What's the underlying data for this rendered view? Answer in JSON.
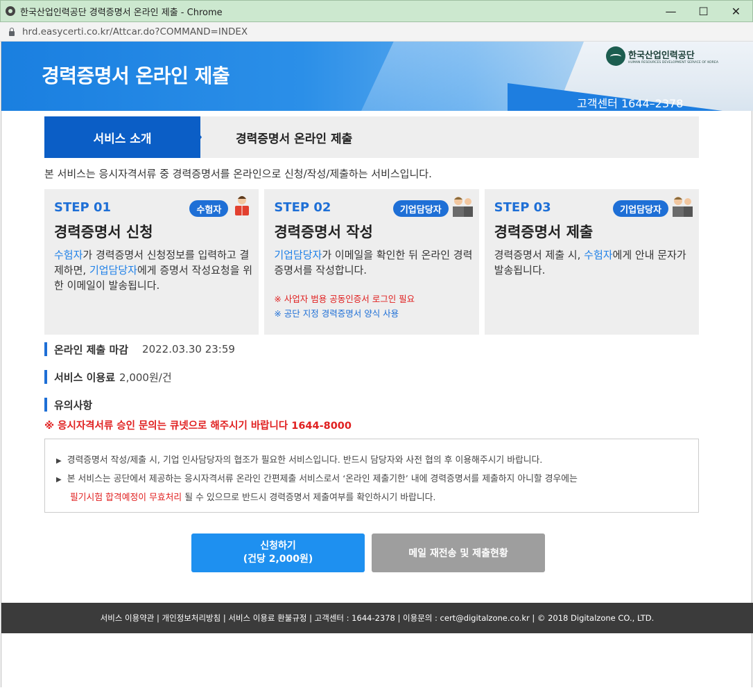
{
  "window": {
    "title": "한국산업인력공단 경력증명서 온라인 제출 - Chrome",
    "url": "hrd.easycerti.co.kr/Attcar.do?COMMAND=INDEX",
    "minimize": "—",
    "maximize": "☐",
    "close": "✕"
  },
  "banner": {
    "title": "경력증명서 온라인 제출",
    "hotline": "고객센터 1644–2378",
    "logo_name": "한국산업인력공단",
    "logo_sub": "HUMAN RESOURCES DEVELOPMENT SERVICE OF KOREA"
  },
  "tabs": {
    "active": "서비스 소개",
    "current": "경력증명서 온라인 제출"
  },
  "intro": "본 서비스는 응시자격서류 중 경력증명서를 온라인으로 신청/작성/제출하는 서비스입니다.",
  "steps": [
    {
      "num": "STEP 01",
      "badge": "수험자",
      "title": "경력증명서 신청",
      "desc_hl1": "수험자",
      "desc_1": "가 경력증명서 신청정보를 입력하고 결제하면, ",
      "desc_hl2": "기업담당자",
      "desc_2": "에게 증명서 작성요청을 위한 이메일이 발송됩니다."
    },
    {
      "num": "STEP 02",
      "badge": "기업담당자",
      "title": "경력증명서 작성",
      "desc_hl1": "기업담당자",
      "desc_1": "가 이메일을 확인한 뒤 온라인 경력증명서를 작성합니다.",
      "note_red": "※ 사업자 범용 공동인증서 로그인 필요",
      "note_blue": "※ 공단 지정 경력증명서 양식 사용"
    },
    {
      "num": "STEP 03",
      "badge": "기업담당자",
      "title": "경력증명서 제출",
      "desc_1": "경력증명서 제출 시, ",
      "desc_hl1": "수험자",
      "desc_2": "에게 안내 문자가 발송됩니다."
    }
  ],
  "info": {
    "deadline_label": "온라인 제출 마감",
    "deadline_value": "2022.03.30 23:59",
    "fee_label": "서비스 이용료",
    "fee_value": "2,000원/건",
    "notice_label": "유의사항"
  },
  "warning": "※ 응시자격서류 승인 문의는 큐넷으로 해주시기 바랍니다 1644-8000",
  "notice": {
    "line1": "경력증명서 작성/제출 시, 기업 인사담당자의 협조가 필요한 서비스입니다. 반드시 담당자와 사전 협의 후 이용해주시기 바랍니다.",
    "line2": "본 서비스는 공단에서 제공하는 응시자격서류 온라인 간편제출 서비스로서 ‘온라인 제출기한’ 내에 경력증명서를 제출하지 아니할 경우에는",
    "line3_red": "필기시험 합격예정이 무효처리",
    "line3": " 될 수 있으므로 반드시 경력증명서 제출여부를 확인하시기 바랍니다."
  },
  "buttons": {
    "apply_line1": "신청하기",
    "apply_line2": "(건당 2,000원)",
    "resend": "메일 재전송 및 제출현황"
  },
  "footer": "서비스 이용약관 | 개인정보처리방침 | 서비스 이용료 환불규정 | 고객센터 : 1644-2378 | 이용문의 : cert@digitalzone.co.kr | © 2018 Digitalzone CO., LTD.",
  "colors": {
    "primary": "#1e6fd6",
    "tab_active": "#0b5ec6",
    "button_primary": "#1e90f0",
    "button_secondary": "#9e9e9e",
    "warning": "#e02020",
    "footer": "#3b3b3b"
  }
}
